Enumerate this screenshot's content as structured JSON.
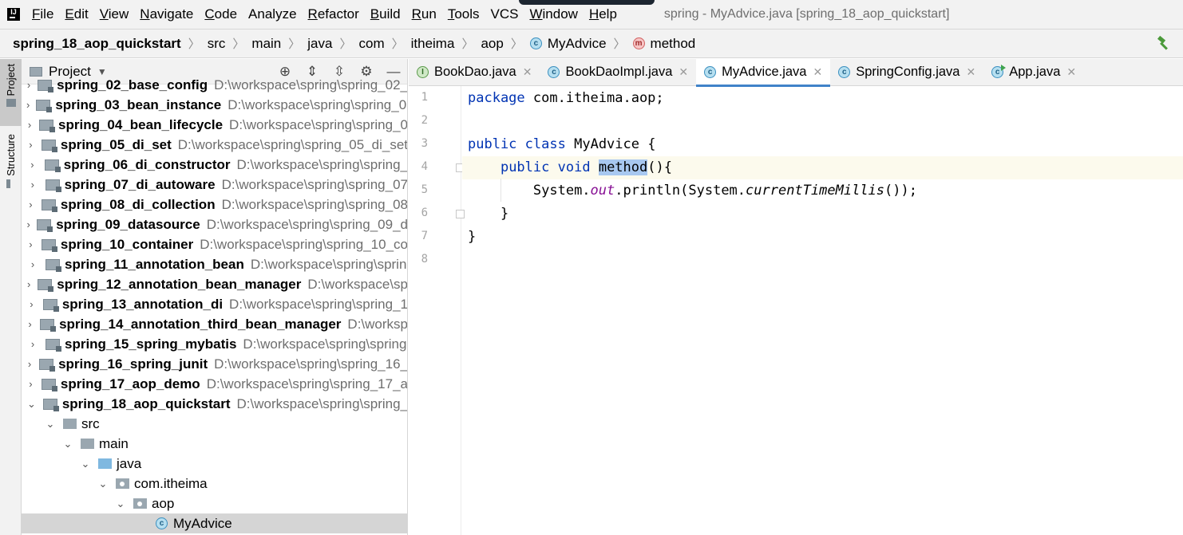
{
  "menubar": {
    "items": [
      {
        "label": "File",
        "mnemonic": "F",
        "rest": "ile"
      },
      {
        "label": "Edit",
        "mnemonic": "E",
        "rest": "dit"
      },
      {
        "label": "View",
        "mnemonic": "V",
        "rest": "iew"
      },
      {
        "label": "Navigate",
        "mnemonic": "N",
        "rest": "avigate"
      },
      {
        "label": "Code",
        "mnemonic": "C",
        "rest": "ode"
      },
      {
        "label": "Analyze",
        "mnemonic": "",
        "rest": "Analyze"
      },
      {
        "label": "Refactor",
        "mnemonic": "R",
        "rest": "efactor"
      },
      {
        "label": "Build",
        "mnemonic": "B",
        "rest": "uild"
      },
      {
        "label": "Run",
        "mnemonic": "R",
        "rest": "un"
      },
      {
        "label": "Tools",
        "mnemonic": "T",
        "rest": "ools"
      },
      {
        "label": "VCS",
        "mnemonic": "",
        "rest": "VCS"
      },
      {
        "label": "Window",
        "mnemonic": "W",
        "rest": "indow"
      },
      {
        "label": "Help",
        "mnemonic": "H",
        "rest": "elp"
      }
    ],
    "window_title": "spring - MyAdvice.java [spring_18_aop_quickstart]"
  },
  "breadcrumb": {
    "items": [
      "spring_18_aop_quickstart",
      "src",
      "main",
      "java",
      "com",
      "itheima",
      "aop",
      "MyAdvice",
      "method"
    ]
  },
  "sidebar": {
    "project_tab": "Project",
    "structure_tab": "Structure"
  },
  "project_panel": {
    "title": "Project",
    "modules": [
      {
        "name": "spring_02_base_config",
        "path": "D:\\workspace\\spring\\spring_02_"
      },
      {
        "name": "spring_03_bean_instance",
        "path": "D:\\workspace\\spring\\spring_03"
      },
      {
        "name": "spring_04_bean_lifecycle",
        "path": "D:\\workspace\\spring\\spring_0"
      },
      {
        "name": "spring_05_di_set",
        "path": "D:\\workspace\\spring\\spring_05_di_set"
      },
      {
        "name": "spring_06_di_constructor",
        "path": "D:\\workspace\\spring\\spring_"
      },
      {
        "name": "spring_07_di_autoware",
        "path": "D:\\workspace\\spring\\spring_07"
      },
      {
        "name": "spring_08_di_collection",
        "path": "D:\\workspace\\spring\\spring_08"
      },
      {
        "name": "spring_09_datasource",
        "path": "D:\\workspace\\spring\\spring_09_d"
      },
      {
        "name": "spring_10_container",
        "path": "D:\\workspace\\spring\\spring_10_co"
      },
      {
        "name": "spring_11_annotation_bean",
        "path": "D:\\workspace\\spring\\sprin"
      },
      {
        "name": "spring_12_annotation_bean_manager",
        "path": "D:\\workspace\\sp"
      },
      {
        "name": "spring_13_annotation_di",
        "path": "D:\\workspace\\spring\\spring_1"
      },
      {
        "name": "spring_14_annotation_third_bean_manager",
        "path": "D:\\worksp"
      },
      {
        "name": "spring_15_spring_mybatis",
        "path": "D:\\workspace\\spring\\spring"
      },
      {
        "name": "spring_16_spring_junit",
        "path": "D:\\workspace\\spring\\spring_16_"
      },
      {
        "name": "spring_17_aop_demo",
        "path": "D:\\workspace\\spring\\spring_17_a"
      },
      {
        "name": "spring_18_aop_quickstart",
        "path": "D:\\workspace\\spring\\spring_"
      }
    ],
    "tree": {
      "src": "src",
      "main": "main",
      "java": "java",
      "pkg": "com.itheima",
      "aop": "aop",
      "file": "MyAdvice"
    }
  },
  "editor": {
    "tabs": [
      {
        "label": "BookDao.java",
        "kind": "interface"
      },
      {
        "label": "BookDaoImpl.java",
        "kind": "class"
      },
      {
        "label": "MyAdvice.java",
        "kind": "class",
        "active": true
      },
      {
        "label": "SpringConfig.java",
        "kind": "class"
      },
      {
        "label": "App.java",
        "kind": "runnable"
      }
    ],
    "line_numbers": [
      "1",
      "2",
      "3",
      "4",
      "5",
      "6",
      "7",
      "8"
    ],
    "code": {
      "l1_kw": "package",
      "l1_rest": " com.itheima.aop;",
      "l3_kw1": "public",
      "l3_kw2": "class",
      "l3_name": "MyAdvice",
      "l3_brace": " {",
      "l4_kw1": "public",
      "l4_kw2": "void",
      "l4_name": "method",
      "l4_rest": "(){",
      "l5_a": "System.",
      "l5_out": "out",
      "l5_b": ".println(System.",
      "l5_call": "currentTimeMillis",
      "l5_c": "());",
      "l6": "}",
      "l7": "}"
    }
  }
}
